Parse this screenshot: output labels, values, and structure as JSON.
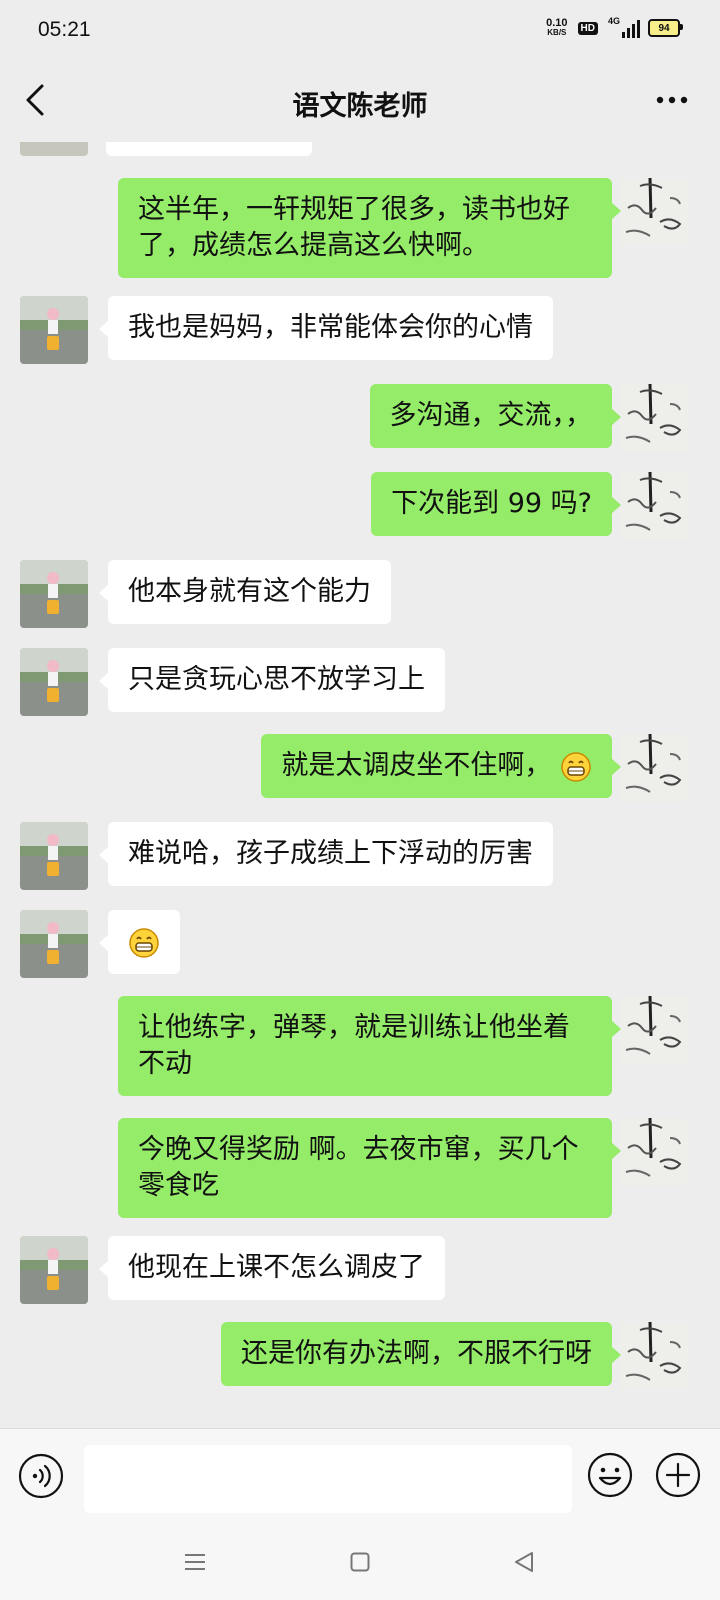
{
  "status_bar": {
    "time": "05:21",
    "net_speed_value": "0.10",
    "net_speed_unit": "KB/S",
    "hd_label": "HD",
    "network_type": "4G",
    "battery": "94"
  },
  "header": {
    "title": "语文陈老师"
  },
  "messages": [
    {
      "side": "out",
      "text": "这半年，一轩规矩了很多，读书也好了，成绩怎么提高这么快啊。"
    },
    {
      "side": "in",
      "text": "我也是妈妈，非常能体会你的心情"
    },
    {
      "side": "out",
      "text": "多沟通，交流，，"
    },
    {
      "side": "out",
      "text": "下次能到 99 吗?"
    },
    {
      "side": "in",
      "text": "他本身就有这个能力"
    },
    {
      "side": "in",
      "text": "只是贪玩心思不放学习上"
    },
    {
      "side": "out",
      "text": "就是太调皮坐不住啊，",
      "emoji": "grin"
    },
    {
      "side": "in",
      "text": "难说哈，孩子成绩上下浮动的厉害"
    },
    {
      "side": "in",
      "text": "",
      "emoji": "grin"
    },
    {
      "side": "out",
      "text": "让他练字，弹琴，就是训练让他坐着不动"
    },
    {
      "side": "out",
      "text": "今晚又得奖励 啊。去夜市窜，买几个零食吃"
    },
    {
      "side": "in",
      "text": "他现在上课不怎么调皮了"
    },
    {
      "side": "out",
      "text": "还是你有办法啊，不服不行呀"
    }
  ],
  "input_bar": {
    "voice_icon": "voice-icon",
    "emoji_icon": "emoji-icon",
    "plus_icon": "plus-icon",
    "value": ""
  },
  "colors": {
    "outgoing_bubble": "#95ec69",
    "incoming_bubble": "#ffffff",
    "background": "#ededed"
  }
}
